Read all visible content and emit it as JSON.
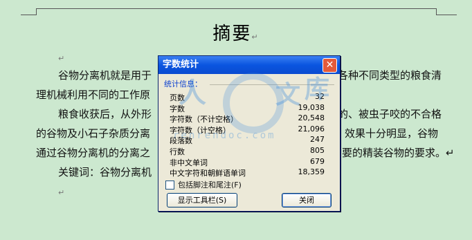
{
  "document": {
    "title": "摘要",
    "paragraph_mark": "↵",
    "lines": [
      "谷物分离机就是用于",
      "理机械利用不同的工作原",
      "粮食收获后，从外形",
      "的谷物及小石子杂质分离",
      "通过谷物分离机的分离之",
      "关键词：谷物分离机"
    ],
    "lines_right": [
      "各种不同类型的粮食清",
      "的、被虫子咬的不合格",
      "效果十分明显，谷物",
      "要的精装谷物的要求。↵"
    ]
  },
  "dialog": {
    "title": "字数统计",
    "close_glyph": "✕",
    "group_label": "统计信息：",
    "stats": [
      {
        "label": "页数",
        "value": "32"
      },
      {
        "label": "字数",
        "value": "19,038"
      },
      {
        "label": "字符数（不计空格）",
        "value": "20,548"
      },
      {
        "label": "字符数（计空格）",
        "value": "21,096"
      },
      {
        "label": "段落数",
        "value": "247"
      },
      {
        "label": "行数",
        "value": "805"
      },
      {
        "label": "非中文单词",
        "value": "679"
      },
      {
        "label": "中文字符和朝鲜语单词",
        "value": "18,359"
      }
    ],
    "checkbox_label": "包括脚注和尾注(F)",
    "checkbox_checked": false,
    "toolbar_button": "显示工具栏(S)",
    "close_button": "关闭"
  },
  "watermark": {
    "chars": [
      "人",
      "文",
      "库"
    ],
    "url": "renrendoc.com"
  }
}
